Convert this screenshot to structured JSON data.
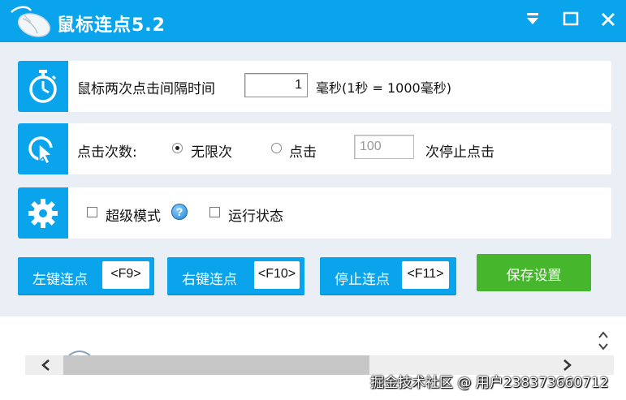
{
  "window": {
    "title": "鼠标连点5.2",
    "logo_icon": "mouse-icon",
    "controls": {
      "minimize_icon": "dropdown-minimize-icon",
      "maximize_icon": "maximize-icon",
      "close_icon": "close-icon"
    }
  },
  "interval_panel": {
    "icon": "stopwatch-icon",
    "label": "鼠标两次点击间隔时间",
    "value": "1",
    "unit_text": "毫秒(1秒 = 1000毫秒)"
  },
  "click_count_panel": {
    "icon": "cursor-click-icon",
    "label": "点击次数:",
    "option_unlimited": "无限次",
    "option_limited": "点击",
    "selected": "无限次",
    "limit_value": "100",
    "suffix": "次停止点击"
  },
  "settings_panel": {
    "icon": "gear-icon",
    "super_mode_label": "超级模式",
    "super_mode_checked": false,
    "help_icon": "help-icon",
    "help_glyph": "?",
    "running_status_label": "运行状态",
    "running_status_checked": false
  },
  "buttons": {
    "left_click": {
      "label": "左键连点",
      "hotkey": "<F9>"
    },
    "right_click": {
      "label": "右键连点",
      "hotkey": "<F10>"
    },
    "stop_click": {
      "label": "停止连点",
      "hotkey": "<F11>"
    },
    "save": {
      "label": "保存设置"
    }
  },
  "watermark": "掘金技术社区 @ 用户238373660712",
  "colors": {
    "accent": "#0aa4ec",
    "save_green": "#46b72c",
    "background": "#e9eff5"
  }
}
